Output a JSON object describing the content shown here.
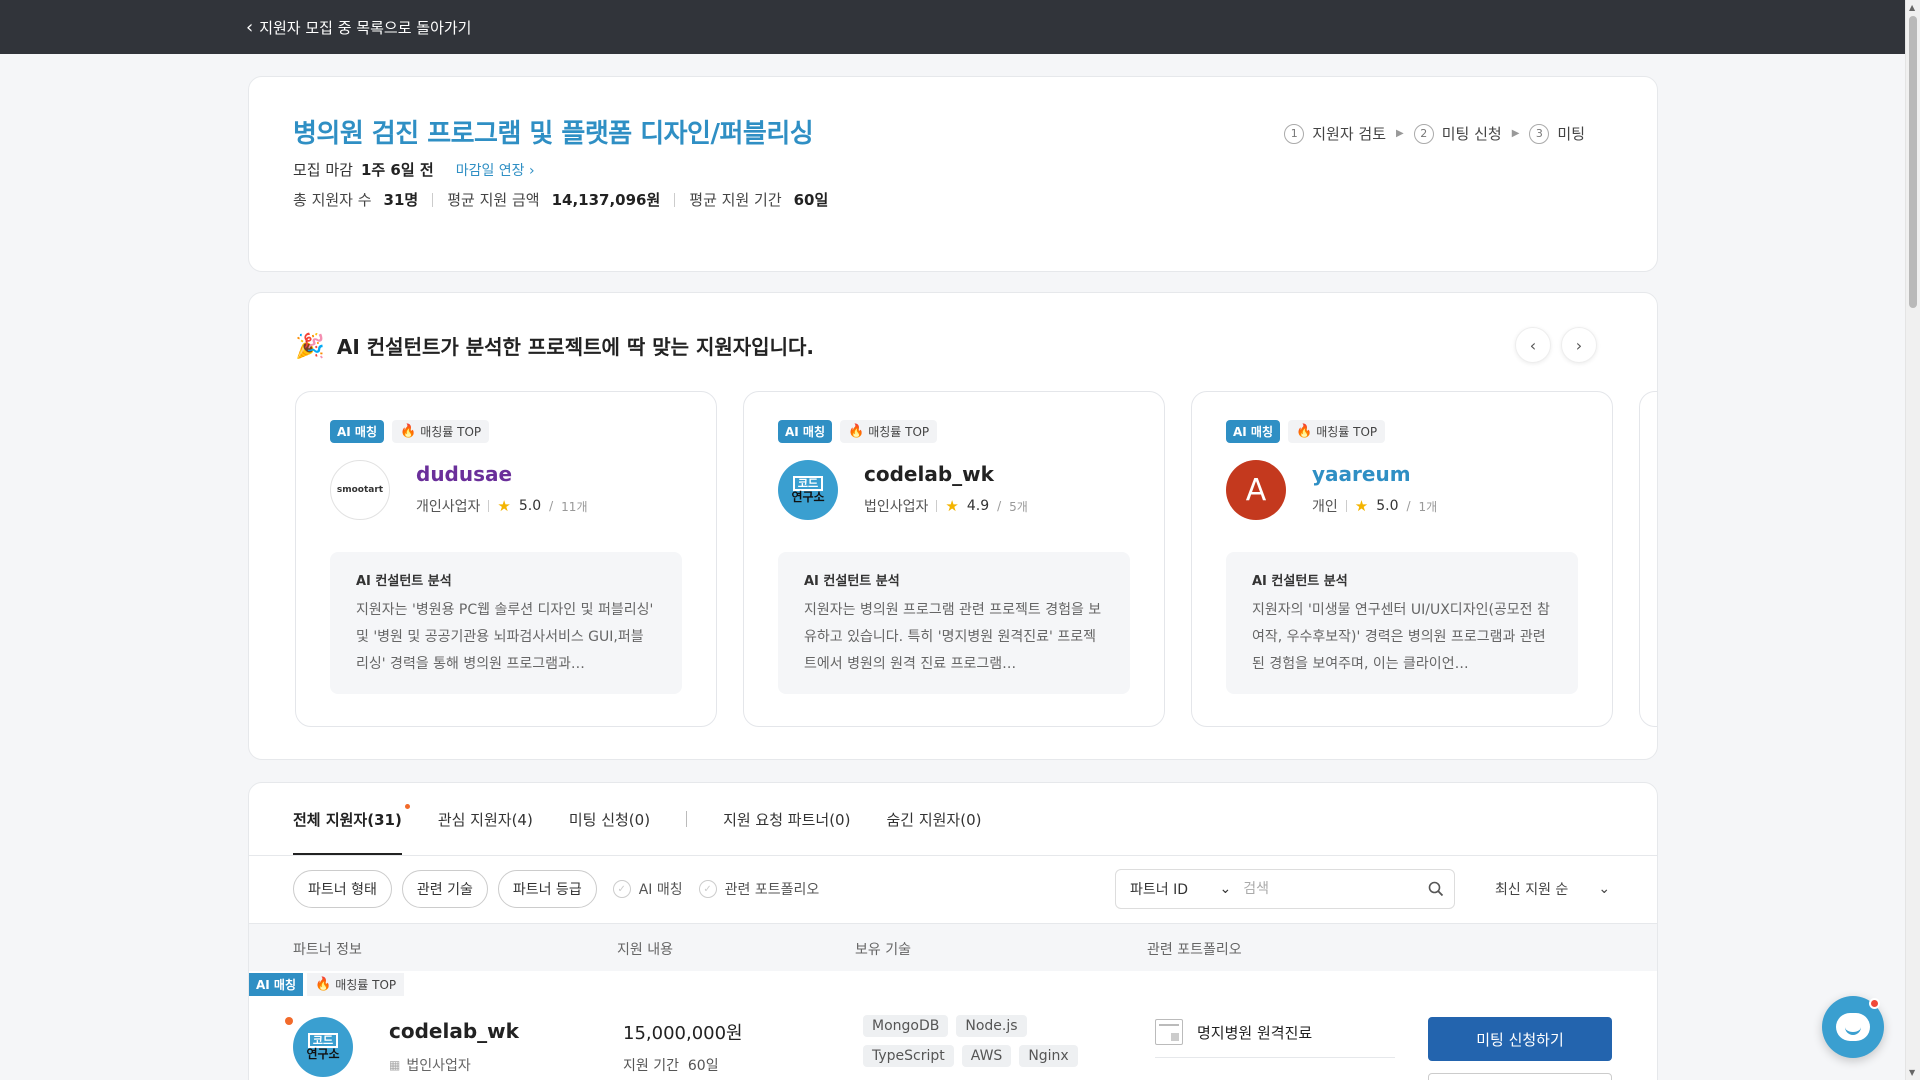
{
  "topbar": {
    "back_label": "지원자 모집 중 목록으로 돌아가기"
  },
  "project": {
    "title": "병의원 검진 프로그램 및 플랫폼 디자인/퍼블리싱",
    "deadline_label": "모집 마감",
    "deadline_value": "1주 6일 전",
    "extend_label": "마감일 연장",
    "stats": [
      {
        "label": "총 지원자 수",
        "value": "31명"
      },
      {
        "label": "평균 지원 금액",
        "value": "14,137,096원"
      },
      {
        "label": "평균 지원 기간",
        "value": "60일"
      }
    ],
    "steps": [
      {
        "num": "1",
        "label": "지원자 검토"
      },
      {
        "num": "2",
        "label": "미팅 신청"
      },
      {
        "num": "3",
        "label": "미팅"
      }
    ]
  },
  "ai_section": {
    "title": "AI 컨설턴트가 분석한 프로젝트에 딱 맞는 지원자입니다.",
    "badge_ai": "AI 매칭",
    "badge_top": "매칭률 TOP",
    "analysis_title": "AI 컨설턴트 분석",
    "cards": [
      {
        "name": "dudusae",
        "avatar_text": "smootart",
        "type": "개인사업자",
        "rating": "5.0",
        "count": "11개",
        "analysis": "지원자는 '병원용 PC웹 솔루션 디자인 및 퍼블리싱' 및 '병원 및 공공기관용 뇌파검사서비스 GUI,퍼블리싱' 경력을 통해 병의원 프로그램과…"
      },
      {
        "name": "codelab_wk",
        "avatar_text_top": "코드",
        "avatar_text_bottom": "연구소",
        "type": "법인사업자",
        "rating": "4.9",
        "count": "5개",
        "analysis": "지원자는 병의원 프로그램 관련 프로젝트 경험을 보유하고 있습니다. 특히 '명지병원 원격진료' 프로젝트에서 병원의 원격 진료 프로그램…"
      },
      {
        "name": "yaareum",
        "avatar_text": "A",
        "type": "개인",
        "rating": "5.0",
        "count": "1개",
        "analysis": "지원자의 '미생물 연구센터 UI/UX디자인(공모전 참여작, 우수후보작)' 경력은 병의원 프로그램과 관련된 경험을 보여주며, 이는 클라이언…"
      }
    ]
  },
  "list": {
    "tabs": [
      {
        "label": "전체 지원자(31)"
      },
      {
        "label": "관심 지원자(4)"
      },
      {
        "label": "미팅 신청(0)"
      },
      {
        "label": "지원 요청 파트너(0)"
      },
      {
        "label": "숨긴 지원자(0)"
      }
    ],
    "filters": [
      "파트너 형태",
      "관련 기술",
      "파트너 등급"
    ],
    "check_options": [
      "AI 매칭",
      "관련 포트폴리오"
    ],
    "search": {
      "select_value": "파트너 ID",
      "placeholder": "검색"
    },
    "sort_label": "최신 지원 순",
    "columns": [
      "파트너 정보",
      "지원 내용",
      "보유 기술",
      "관련 포트폴리오"
    ],
    "row": {
      "badge_ai": "AI 매칭",
      "badge_top": "매칭률 TOP",
      "name": "codelab_wk",
      "avatar_text_top": "코드",
      "avatar_text_bottom": "연구소",
      "type": "법인사업자",
      "amount": "15,000,000원",
      "period_label": "지원 기간",
      "period_value": "60일",
      "skills": [
        "MongoDB",
        "Node.js",
        "TypeScript",
        "AWS",
        "Nginx"
      ],
      "portfolio": "명지병원 원격진료",
      "meeting_button": "미팅 신청하기"
    }
  }
}
